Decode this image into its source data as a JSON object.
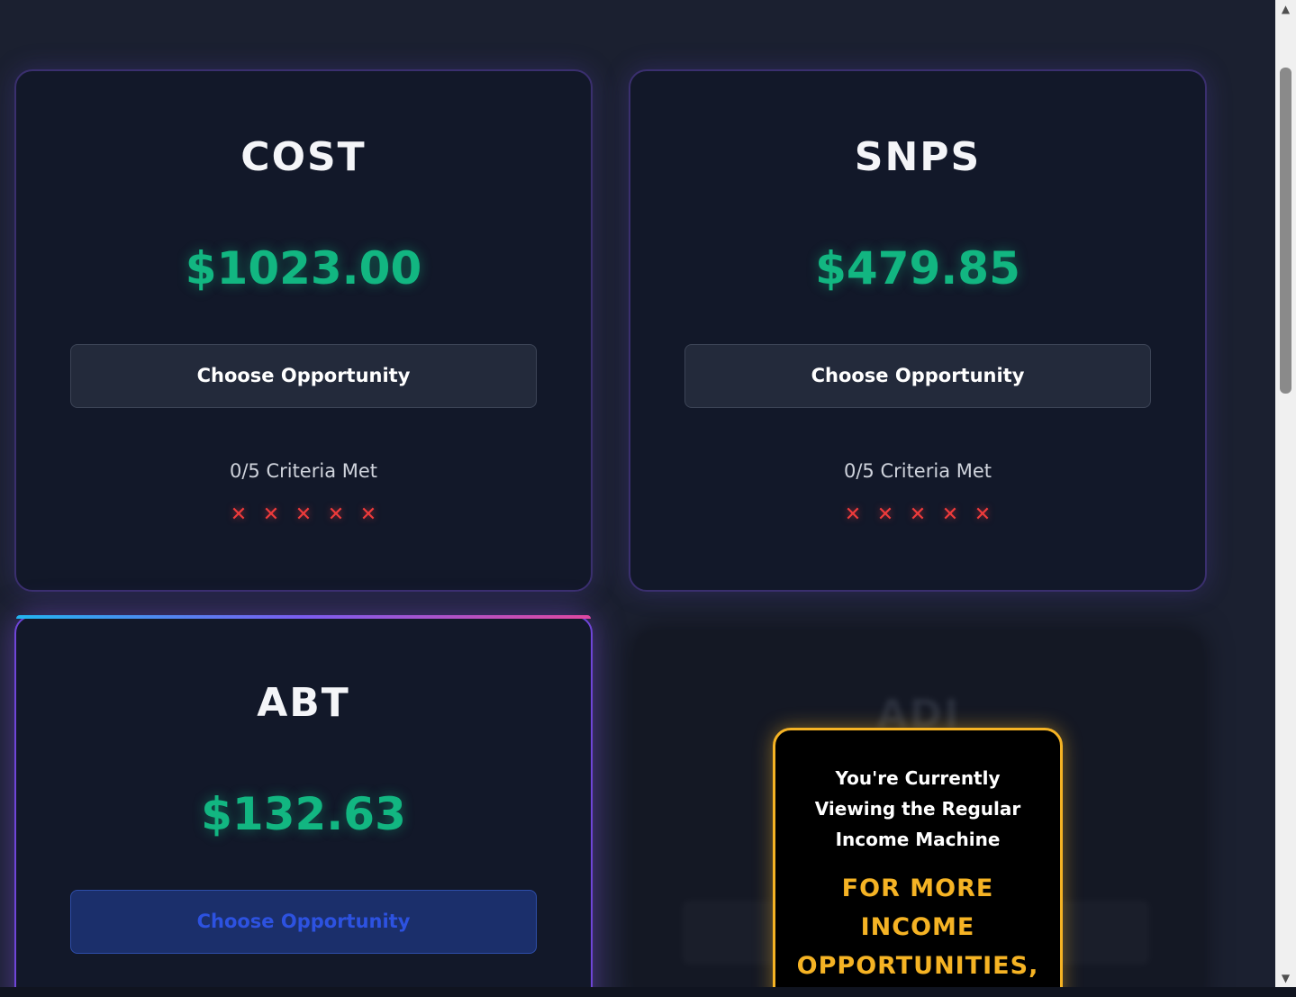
{
  "cards": [
    {
      "ticker": "COST",
      "price": "$1023.00",
      "button_label": "Choose Opportunity",
      "criteria": "0/5 Criteria Met",
      "marks": [
        "✕",
        "✕",
        "✕",
        "✕",
        "✕"
      ]
    },
    {
      "ticker": "SNPS",
      "price": "$479.85",
      "button_label": "Choose Opportunity",
      "criteria": "0/5 Criteria Met",
      "marks": [
        "✕",
        "✕",
        "✕",
        "✕",
        "✕"
      ]
    },
    {
      "ticker": "ABT",
      "price": "$132.63",
      "button_label": "Choose Opportunity"
    }
  ],
  "locked_card": {
    "ticker": "ADI"
  },
  "popup": {
    "message": "You're Currently Viewing the Regular Income Machine",
    "cta": "FOR MORE INCOME OPPORTUNITIES,"
  },
  "colors": {
    "background": "#1b2030",
    "card": "#121829",
    "price_green": "#12b681",
    "cross_red": "#ef3b3b",
    "popup_gold": "#f5b324"
  },
  "icons": {
    "criteria_fail": "cross-icon",
    "scroll_up": "scroll-up-arrow-icon",
    "scroll_down": "scroll-down-arrow-icon"
  }
}
